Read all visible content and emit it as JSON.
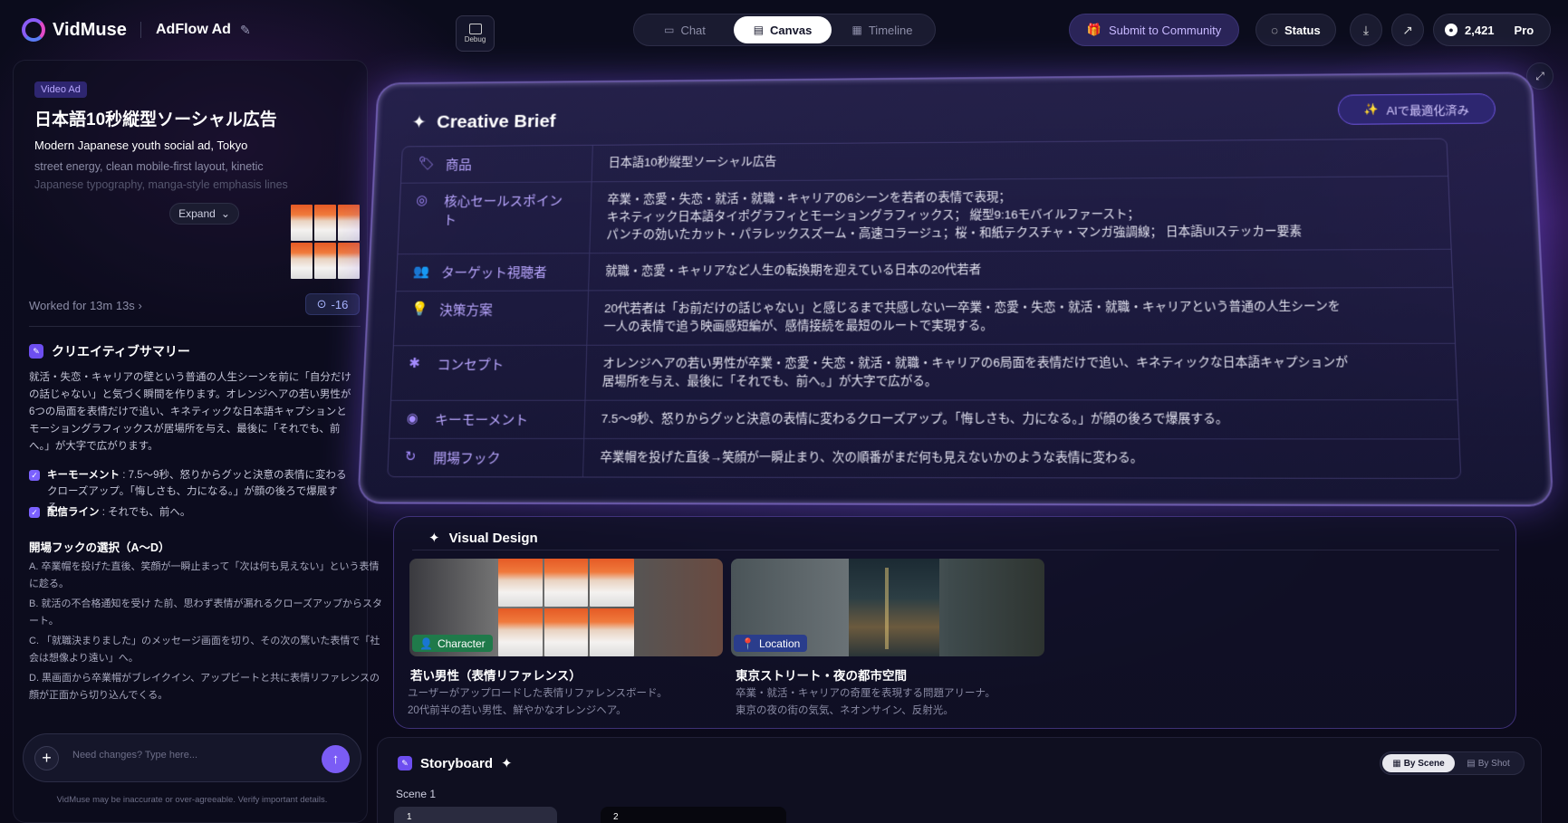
{
  "app": {
    "name": "VidMuse",
    "project": "AdFlow Ad",
    "debug_label": "Debug"
  },
  "tabs": [
    {
      "label": "Chat",
      "icon": "chat-icon"
    },
    {
      "label": "Canvas",
      "icon": "canvas-icon",
      "active": true
    },
    {
      "label": "Timeline",
      "icon": "timeline-icon"
    }
  ],
  "header": {
    "submit_label": "Submit to Community",
    "status_label": "Status",
    "credits": "2,421",
    "plan": "Pro"
  },
  "left": {
    "chip": "Video Ad",
    "title": "日本語10秒縦型ソーシャル広告",
    "subtitle": "Modern Japanese youth social ad, Tokyo",
    "desc_line1": "street energy, clean mobile-first layout, kinetic",
    "desc_line2": "Japanese typography, manga-style emphasis lines",
    "expand_label": "Expand",
    "worked": "Worked for 13m 13s",
    "counter": "-16",
    "summary_title": "クリエイティブサマリー",
    "summary_text": "就活・失恋・キャリアの壁という普通の人生シーンを前に「自分だけの話じゃない」と気づく瞬間を作ります。オレンジヘアの若い男性が6つの局面を表情だけで追い、キネティックな日本語キャプションとモーショングラフィックスが居場所を与え、最後に「それでも、前へ。」が大字で広がります。",
    "key_moment_label": "キーモーメント",
    "key_moment_text": "7.5〜9秒、怒りからグッと決意の表情に変わるクローズアップ。「悔しさも、力になる。」が顔の後ろで爆展する。",
    "tagline_label": "配信ライン",
    "tagline_text": "それでも、前へ。",
    "hooks_title": "開場フックの選択（A〜D）",
    "hooks": [
      "A. 卒業帽を投げた直後、笑顔が一瞬止まって「次は何も見えない」という表情に趁る。",
      "B. 就活の不合格通知を受け た前、思わず表情が漏れるクローズアップからスタート。",
      "C. 「就職決まりました」のメッセージ画面を切り、その次の驚いた表情で「社会は想像より遠い」へ。",
      "D. 黒画面から卒業帽がブレイクイン、アップビートと共に表情リファレンスの顔が正面から切り込んでくる。"
    ],
    "input_placeholder": "Need changes? Type here...",
    "disclaimer": "VidMuse may be inaccurate or over-agreeable. Verify important details."
  },
  "brief": {
    "title": "Creative Brief",
    "optimized_label": "AIで最適化済み",
    "rows": [
      {
        "key": "商品",
        "icon": "tag-icon",
        "value": "日本語10秒縦型ソーシャル広告"
      },
      {
        "key": "核心セールスポイント",
        "icon": "target-icon",
        "value": "卒業・恋愛・失恋・就活・就職・キャリアの6シーンを若者の表情で表現；\nキネティック日本語タイポグラフィとモーショングラフィックス； 縦型9:16モバイルファースト；\nパンチの効いたカット・パラレックスズーム・高速コラージュ；桜・和紙テクスチャ・マンガ強調線； 日本語UIステッカー要素"
      },
      {
        "key": "ターゲット視聴者",
        "icon": "users-icon",
        "value": "就職・恋愛・キャリアなど人生の転換期を迎えている日本の20代若者"
      },
      {
        "key": "決策方案",
        "icon": "bulb-icon",
        "value": "20代若者は「お前だけの話じゃない」と感じるまで共感しない一卒業・恋愛・失恋・就活・就職・キャリアという普通の人生シーンを\n一人の表情で追う映画感短編が、感情接続を最短のルートで実現する。"
      },
      {
        "key": "コンセプト",
        "icon": "puzzle-icon",
        "value": "オレンジヘアの若い男性が卒業・恋愛・失恋・就活・就職・キャリアの6局面を表情だけで追い、キネティックな日本語キャプションが\n居場所を与え、最後に「それでも、前へ。」が大字で広がる。"
      },
      {
        "key": "キーモーメント",
        "icon": "focus-icon",
        "value": "7.5〜9秒、怒りからグッと決意の表情に変わるクローズアップ。「悔しさも、力になる。」が顔の後ろで爆展する。"
      },
      {
        "key": "開場フック",
        "icon": "hook-icon",
        "value": "卒業帽を投げた直後→笑顔が一瞬止まり、次の順番がまだ何も見えないかのような表情に変わる。"
      }
    ]
  },
  "visual": {
    "title": "Visual Design",
    "cards": [
      {
        "tag": "Character",
        "title": "若い男性（表情リファレンス）",
        "desc1": "ユーザーがアップロードした表情リファレンスボード。",
        "desc2": "20代前半の若い男性、鮮やかなオレンジヘア。"
      },
      {
        "tag": "Location",
        "title": "東京ストリート・夜の都市空間",
        "desc1": "卒業・就活・キャリアの奇厘を表現する問題アリーナ。",
        "desc2": "東京の夜の街の気気、ネオンサイン、反射光。"
      }
    ]
  },
  "storyboard": {
    "title": "Storyboard",
    "by_scene": "By Scene",
    "by_shot": "By Shot",
    "scene_label": "Scene 1",
    "shot1": "1",
    "shot2": "2"
  }
}
